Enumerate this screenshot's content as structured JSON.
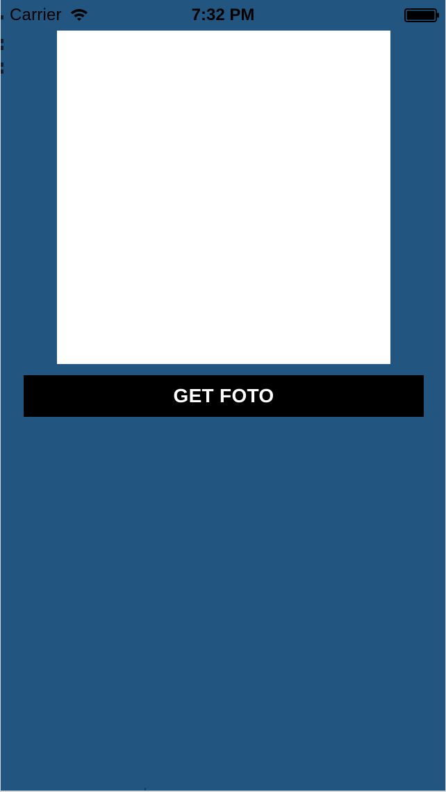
{
  "status_bar": {
    "carrier": "Carrier",
    "time": "7:32 PM",
    "wifi_icon": "wifi-icon",
    "battery_icon": "battery-icon"
  },
  "main": {
    "photo_placeholder": "",
    "get_foto_label": "GET FOTO"
  },
  "colors": {
    "background": "#22557f",
    "photo_frame": "#ffffff",
    "button_background": "#000000",
    "button_text": "#ffffff"
  }
}
